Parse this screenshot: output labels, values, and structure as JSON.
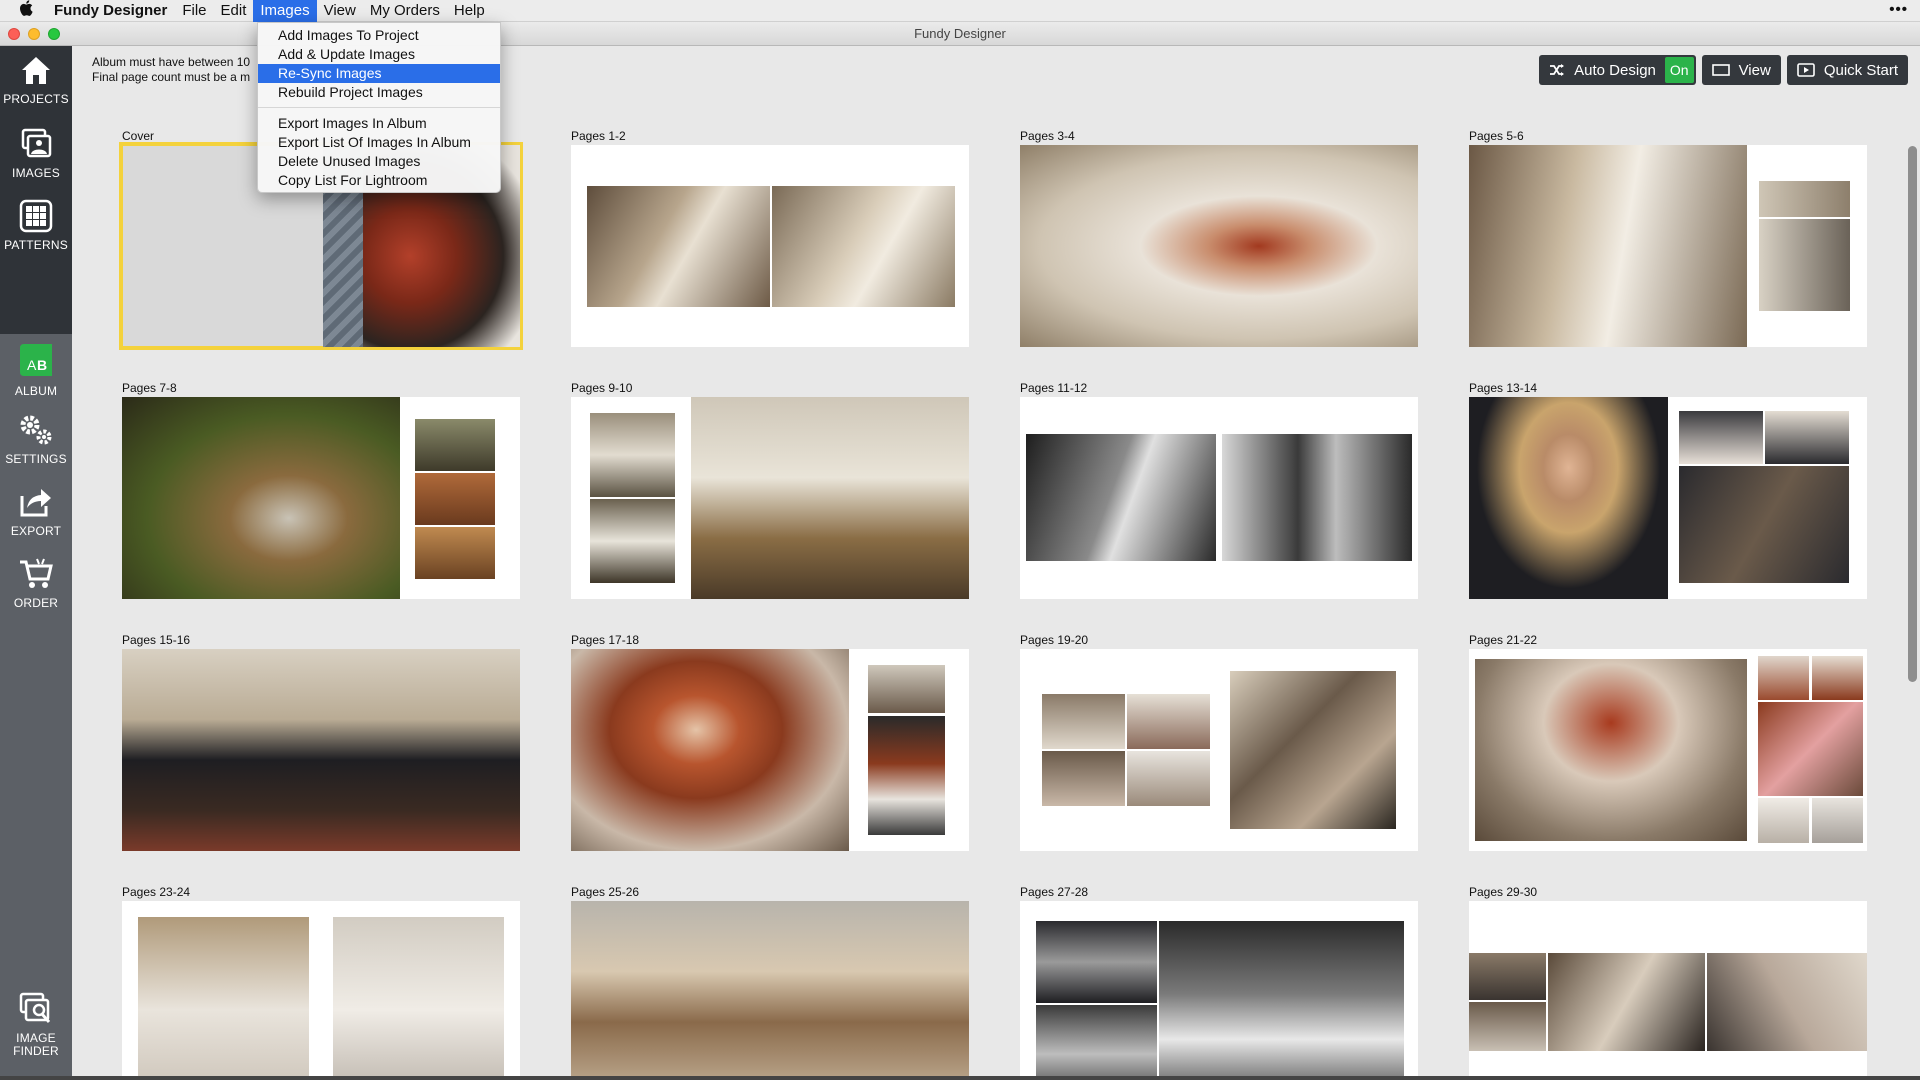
{
  "menubar": {
    "apple": "",
    "app_name": "Fundy Designer",
    "items": [
      "File",
      "Edit",
      "Images",
      "View",
      "My Orders",
      "Help"
    ],
    "active_item": "Images",
    "extras": "•••"
  },
  "window": {
    "title": "Fundy Designer"
  },
  "images_menu": {
    "group1": [
      "Add Images To Project",
      "Add & Update Images",
      "Re-Sync Images",
      "Rebuild Project Images"
    ],
    "group2": [
      "Export Images In Album",
      "Export List Of Images In Album",
      "Delete Unused Images",
      "Copy List For Lightroom"
    ],
    "highlighted": "Re-Sync Images"
  },
  "sidebar": {
    "items": [
      {
        "label": "PROJECTS",
        "icon": "home-icon"
      },
      {
        "label": "IMAGES",
        "icon": "images-icon"
      },
      {
        "label": "PATTERNS",
        "icon": "patterns-icon"
      },
      {
        "label": "ALBUM",
        "icon": "album-icon"
      },
      {
        "label": "SETTINGS",
        "icon": "gears-icon"
      },
      {
        "label": "EXPORT",
        "icon": "export-icon"
      },
      {
        "label": "ORDER",
        "icon": "cart-icon"
      },
      {
        "label": "IMAGE FINDER",
        "icon": "image-finder-icon"
      }
    ]
  },
  "notice": {
    "line1": "Album must have between 10",
    "line2": "Final page count must be a m"
  },
  "toolbar": {
    "auto_design": "Auto Design",
    "auto_design_state": "On",
    "view": "View",
    "quick_start": "Quick Start"
  },
  "spreads": [
    {
      "label": "Cover"
    },
    {
      "label": "Pages 1-2"
    },
    {
      "label": "Pages 3-4"
    },
    {
      "label": "Pages 5-6"
    },
    {
      "label": "Pages 7-8"
    },
    {
      "label": "Pages 9-10"
    },
    {
      "label": "Pages 11-12"
    },
    {
      "label": "Pages 13-14"
    },
    {
      "label": "Pages 15-16"
    },
    {
      "label": "Pages 17-18"
    },
    {
      "label": "Pages 19-20"
    },
    {
      "label": "Pages 21-22"
    },
    {
      "label": "Pages 23-24"
    },
    {
      "label": "Pages 25-26"
    },
    {
      "label": "Pages 27-28"
    },
    {
      "label": "Pages 29-30"
    }
  ],
  "selected_spread": "Cover",
  "colors": {
    "accent_blue": "#2a6ee8",
    "selection_yellow": "#f4d23c",
    "toggle_green": "#2bb34a",
    "sidebar_dark": "#2f3338",
    "album_section": "#5c6066"
  }
}
